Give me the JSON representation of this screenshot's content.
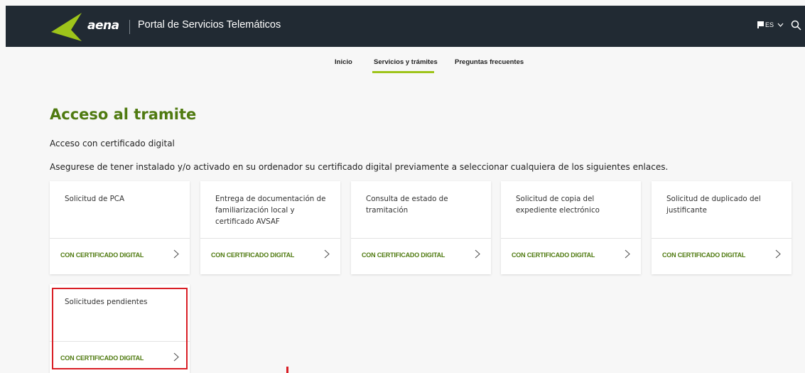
{
  "header": {
    "brand": "aena",
    "title": "Portal de Servicios Telemáticos",
    "language": "ES",
    "colors": {
      "bar": "#212a33",
      "accent": "#9ec41a"
    }
  },
  "nav": {
    "items": [
      "Inicio",
      "Servicios y trámites",
      "Preguntas frecuentes"
    ],
    "active": "Servicios y trámites"
  },
  "main": {
    "title": "Acceso al tramite",
    "subtitle": "Acceso con certificado digital",
    "intro": "Asegurese de tener instalado y/o activado en su ordenador su certificado digital previamente a seleccionar cualquiera de los siguientes enlaces.",
    "cards": [
      {
        "title": "Solicitud de PCA",
        "link": "CON CERTIFICADO DIGITAL"
      },
      {
        "title": "Entrega de documentación de familiarización local y certificado AVSAF",
        "link": "CON CERTIFICADO DIGITAL"
      },
      {
        "title": "Consulta de estado de tramitación",
        "link": "CON CERTIFICADO DIGITAL"
      },
      {
        "title": "Solicitud de copia del expediente electrónico",
        "link": "CON CERTIFICADO DIGITAL"
      },
      {
        "title": "Solicitud de duplicado del justificante",
        "link": "CON CERTIFICADO DIGITAL"
      },
      {
        "title": "Solicitudes pendientes",
        "link": "CON CERTIFICADO DIGITAL"
      }
    ]
  }
}
